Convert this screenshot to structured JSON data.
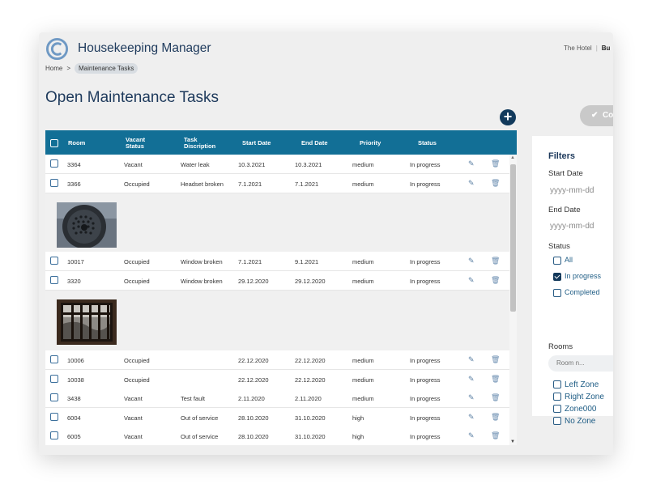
{
  "app": {
    "title": "Housekeeping Manager"
  },
  "top_links": {
    "hotel": "The Hotel",
    "separator": "|",
    "user": "Bu"
  },
  "breadcrumb": {
    "home": "Home",
    "arrow": ">",
    "current": "Maintenance Tasks"
  },
  "page": {
    "title": "Open Maintenance Tasks",
    "add_label": "+",
    "complete_label": "Co",
    "complete_icon": "check-icon"
  },
  "table": {
    "headers": [
      "Room",
      "Vacant Status",
      "Task Discription",
      "Start Date",
      "End Date",
      "Priority",
      "Status"
    ],
    "rows": [
      {
        "room": "3364",
        "vacant": "Vacant",
        "task": "Water leak",
        "start": "10.3.2021",
        "end": "10.3.2021",
        "priority": "medium",
        "status": "In progress"
      },
      {
        "room": "3366",
        "vacant": "Occupied",
        "task": "Headset broken",
        "start": "7.1.2021",
        "end": "7.1.2021",
        "priority": "medium",
        "status": "In progress"
      },
      {
        "room": "10017",
        "vacant": "Occupied",
        "task": "Window broken",
        "start": "7.1.2021",
        "end": "9.1.2021",
        "priority": "medium",
        "status": "In progress"
      },
      {
        "room": "3320",
        "vacant": "Occupied",
        "task": "Window broken",
        "start": "29.12.2020",
        "end": "29.12.2020",
        "priority": "medium",
        "status": "In progress"
      },
      {
        "room": "10006",
        "vacant": "Occupied",
        "task": "",
        "start": "22.12.2020",
        "end": "22.12.2020",
        "priority": "medium",
        "status": "In progress"
      },
      {
        "room": "10038",
        "vacant": "Occupied",
        "task": "",
        "start": "22.12.2020",
        "end": "22.12.2020",
        "priority": "medium",
        "status": "In progress"
      },
      {
        "room": "3438",
        "vacant": "Vacant",
        "task": "Test fault",
        "start": "2.11.2020",
        "end": "2.11.2020",
        "priority": "medium",
        "status": "In progress"
      },
      {
        "room": "6004",
        "vacant": "Vacant",
        "task": "Out of service",
        "start": "28.10.2020",
        "end": "31.10.2020",
        "priority": "high",
        "status": "In progress"
      },
      {
        "room": "6005",
        "vacant": "Vacant",
        "task": "Out of service",
        "start": "28.10.2020",
        "end": "31.10.2020",
        "priority": "high",
        "status": "In progress"
      }
    ],
    "edit_icon": "✎",
    "delete_icon": "🗑"
  },
  "filters": {
    "title": "Filters",
    "start_date_label": "Start Date",
    "start_date_placeholder": "yyyy-mm-dd",
    "end_date_label": "End Date",
    "end_date_placeholder": "yyyy-mm-dd",
    "status_label": "Status",
    "status_options": [
      {
        "label": "All",
        "checked": false
      },
      {
        "label": "In progress",
        "checked": true
      },
      {
        "label": "Completed",
        "checked": false
      }
    ],
    "rooms_label": "Rooms",
    "room_search_placeholder": "Room n...",
    "zones": [
      "Left Zone",
      "Right Zone",
      "Zone000",
      "No Zone"
    ]
  },
  "colors": {
    "header_bg": "#126f96",
    "title": "#1e3a5c",
    "accent": "#123a5c"
  }
}
